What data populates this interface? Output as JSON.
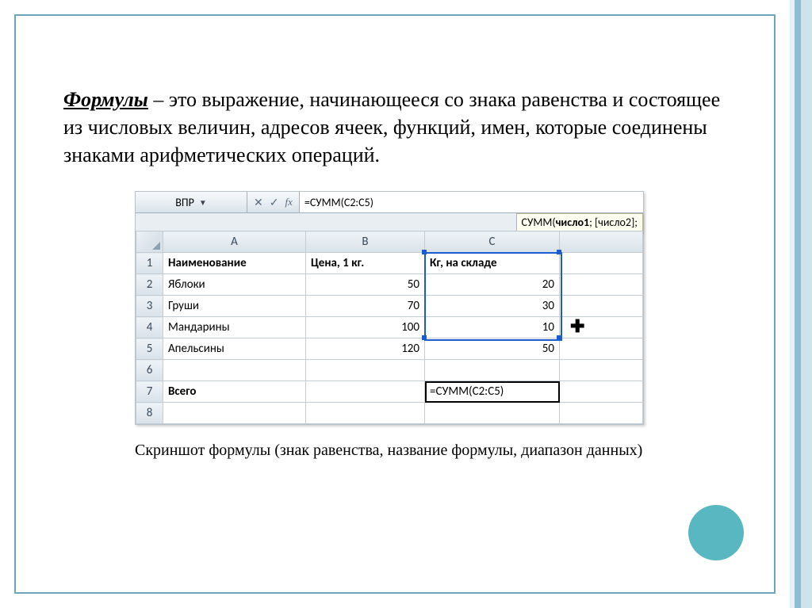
{
  "definition": {
    "term": "Формулы",
    "rest": " – это выражение, начинающееся со знака равенства и состоящее из числовых величин, адресов ячеек, функций, имен, которые соединены знаками арифметических операций."
  },
  "caption": "Скриншот формулы (знак равенства, название формулы, диапазон данных)",
  "excel": {
    "name_box": "ВПР",
    "fx_buttons": {
      "cancel": "✕",
      "enter": "✓",
      "fx": "fx"
    },
    "formula_bar": "=СУММ(C2:C5)",
    "tooltip_func": "СУММ(",
    "tooltip_bold": "число1",
    "tooltip_rest": "; [число2];",
    "columns": [
      "A",
      "B",
      "C"
    ],
    "row_nums": [
      "1",
      "2",
      "3",
      "4",
      "5",
      "6",
      "7",
      "8"
    ],
    "headers": {
      "a": "Наименование",
      "b": "Цена, 1 кг.",
      "c": "Кг, на складе"
    },
    "rows": [
      {
        "a": "Яблоки",
        "b": "50",
        "c": "20"
      },
      {
        "a": "Груши",
        "b": "70",
        "c": "30"
      },
      {
        "a": "Мандарины",
        "b": "100",
        "c": "10"
      },
      {
        "a": "Апельсины",
        "b": "120",
        "c": "50"
      }
    ],
    "total_label": "Всего",
    "active_formula": "=СУММ(C2:C5)"
  },
  "chart_data": {
    "type": "table",
    "title": "",
    "columns": [
      "Наименование",
      "Цена, 1 кг.",
      "Кг, на складе"
    ],
    "rows": [
      [
        "Яблоки",
        50,
        20
      ],
      [
        "Груши",
        70,
        30
      ],
      [
        "Мандарины",
        100,
        10
      ],
      [
        "Апельсины",
        120,
        50
      ]
    ],
    "formula_cell": {
      "address": "C7",
      "formula": "=СУММ(C2:C5)"
    }
  }
}
